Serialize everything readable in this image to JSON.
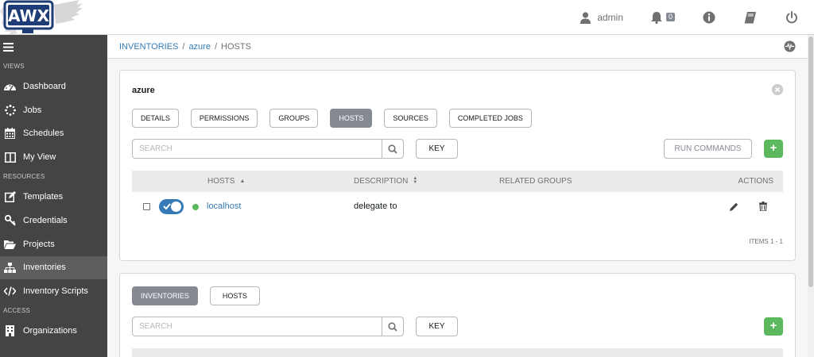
{
  "header": {
    "logo_text": "AWX",
    "user_name": "admin",
    "notification_count": "0"
  },
  "sidebar": {
    "sections": [
      {
        "title": "VIEWS",
        "items": [
          {
            "label": "Dashboard",
            "icon": "dashboard-icon"
          },
          {
            "label": "Jobs",
            "icon": "spinner-icon"
          },
          {
            "label": "Schedules",
            "icon": "calendar-icon"
          },
          {
            "label": "My View",
            "icon": "columns-icon"
          }
        ]
      },
      {
        "title": "RESOURCES",
        "items": [
          {
            "label": "Templates",
            "icon": "pencil-square-icon"
          },
          {
            "label": "Credentials",
            "icon": "key-icon"
          },
          {
            "label": "Projects",
            "icon": "folder-open-icon"
          },
          {
            "label": "Inventories",
            "icon": "sitemap-icon",
            "active": true
          },
          {
            "label": "Inventory Scripts",
            "icon": "code-icon"
          }
        ]
      },
      {
        "title": "ACCESS",
        "items": [
          {
            "label": "Organizations",
            "icon": "building-icon"
          }
        ]
      }
    ]
  },
  "breadcrumb": {
    "items": [
      "INVENTORIES",
      "azure"
    ],
    "current": "HOSTS"
  },
  "inventory_panel": {
    "title": "azure",
    "tabs": [
      "DETAILS",
      "PERMISSIONS",
      "GROUPS",
      "HOSTS",
      "SOURCES",
      "COMPLETED JOBS"
    ],
    "active_tab": "HOSTS",
    "search_placeholder": "SEARCH",
    "key_label": "KEY",
    "run_commands_label": "RUN COMMANDS",
    "add_label": "+",
    "columns": {
      "hosts": "HOSTS",
      "description": "DESCRIPTION",
      "related_groups": "RELATED GROUPS",
      "actions": "ACTIONS"
    },
    "rows": [
      {
        "name": "localhost",
        "description": "delegate to",
        "enabled": true,
        "status": "ok"
      }
    ],
    "items_label": "ITEMS  1 - 1"
  },
  "lower_panel": {
    "tabs": [
      "INVENTORIES",
      "HOSTS"
    ],
    "active_tab": "INVENTORIES",
    "search_placeholder": "SEARCH",
    "key_label": "KEY",
    "add_label": "+"
  },
  "colors": {
    "sidebar_bg": "#444444",
    "link": "#337ab7",
    "success": "#5cb85c",
    "active_tab": "#848992"
  }
}
